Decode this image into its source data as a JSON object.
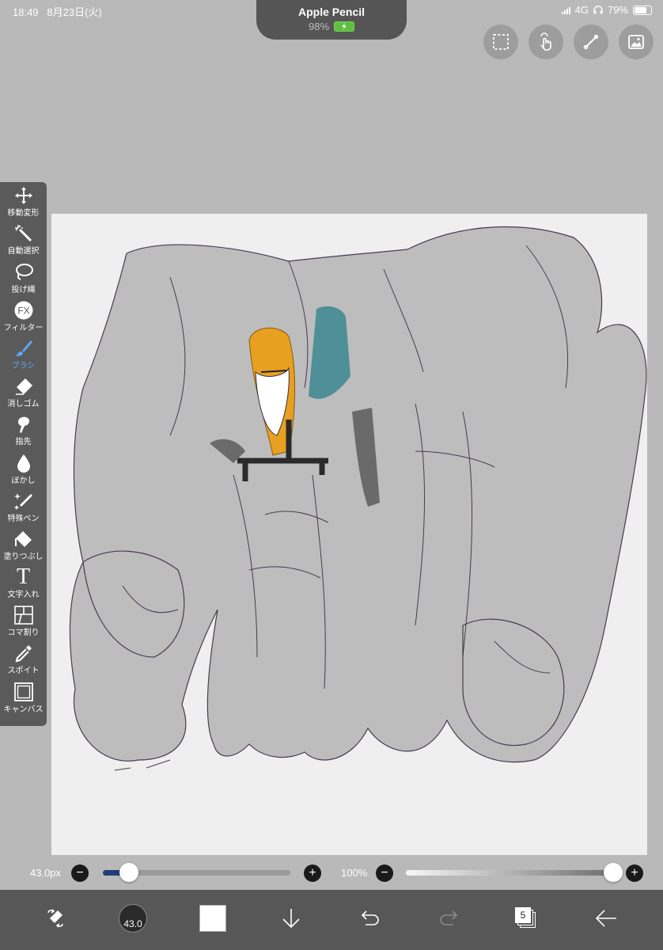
{
  "status_bar": {
    "time": "18:49",
    "date": "8月23日(火)",
    "network": "4G",
    "battery": "79%"
  },
  "pencil": {
    "name": "Apple Pencil",
    "battery": "98%"
  },
  "top_buttons": [
    {
      "icon": "selection-icon"
    },
    {
      "icon": "gesture-icon"
    },
    {
      "icon": "ruler-icon"
    },
    {
      "icon": "material-icon"
    }
  ],
  "tools": [
    {
      "label": "移動変形",
      "icon": "move-icon"
    },
    {
      "label": "自動選択",
      "icon": "magic-wand-icon"
    },
    {
      "label": "投げ縄",
      "icon": "lasso-icon"
    },
    {
      "label": "フィルター",
      "icon": "fx-icon",
      "text": "FX"
    },
    {
      "label": "ブラシ",
      "icon": "brush-icon",
      "active": true
    },
    {
      "label": "消しゴム",
      "icon": "eraser-icon"
    },
    {
      "label": "指先",
      "icon": "finger-icon"
    },
    {
      "label": "ぼかし",
      "icon": "blur-icon"
    },
    {
      "label": "特殊ペン",
      "icon": "special-pen-icon"
    },
    {
      "label": "塗りつぶし",
      "icon": "fill-icon"
    },
    {
      "label": "文字入れ",
      "icon": "text-icon",
      "text": "T"
    },
    {
      "label": "コマ割り",
      "icon": "panel-icon"
    },
    {
      "label": "スポイト",
      "icon": "eyedropper-icon"
    },
    {
      "label": "キャンバス",
      "icon": "canvas-icon"
    }
  ],
  "sliders": {
    "size_value": "43.0px",
    "size_level": 0.14,
    "opacity_value": "100%",
    "opacity_level": 1.0,
    "minus": "−",
    "plus": "+"
  },
  "bottom_bar": {
    "brush_size": "43.0",
    "layers_count": "5"
  },
  "colors": {
    "accent": "#5fa8ff",
    "palette_bg": "#5a5a5a",
    "canvas_bg": "#efefef",
    "primary_color": "#ffffff"
  }
}
